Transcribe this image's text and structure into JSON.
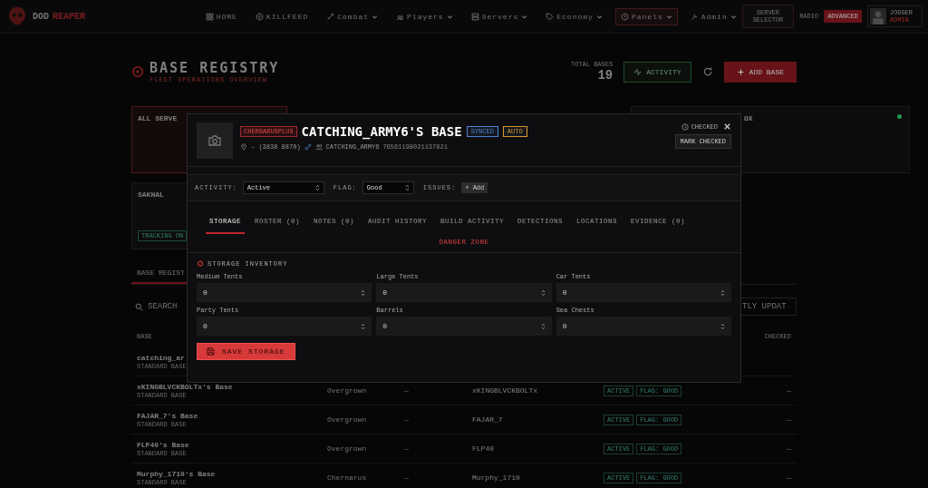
{
  "nav": {
    "brand_first": "DOD",
    "brand_second": "REAPER",
    "items": [
      {
        "label": "HOME",
        "dropdown": false,
        "selected": false
      },
      {
        "label": "KILLFEED",
        "dropdown": false,
        "selected": false
      },
      {
        "label": "Combat",
        "dropdown": true,
        "selected": false
      },
      {
        "label": "Players",
        "dropdown": true,
        "selected": false
      },
      {
        "label": "Servers",
        "dropdown": true,
        "selected": false
      },
      {
        "label": "Economy",
        "dropdown": true,
        "selected": false
      },
      {
        "label": "Panels",
        "dropdown": true,
        "selected": true
      },
      {
        "label": "Admin",
        "dropdown": true,
        "selected": false
      }
    ],
    "server_selector": "SERVER SELECTOR",
    "radio": "RADIO",
    "advanced": "ADVANCED",
    "user_name": "JOGGER",
    "user_role": "ADMIN"
  },
  "header": {
    "title": "BASE REGISTRY",
    "subtitle": "FLEET OPERATIONS OVERVIEW",
    "total_label": "TOTAL BASES",
    "total_value": "19",
    "activity_button": "ACTIVITY",
    "add_button": "ADD BASE"
  },
  "cards": [
    {
      "title": "ALL SERVE",
      "selected": true
    },
    {
      "title": "SAKHAL",
      "selected": false,
      "badge": "TRACKING ON"
    }
  ],
  "side_card": {
    "title": "OX"
  },
  "registry_tab": "BASE REGIST",
  "search_placeholder": "SEARCH",
  "sort_label": "TLY UPDAT",
  "table": {
    "columns": [
      "BASE",
      "CHECKED"
    ],
    "rows": [
      {
        "name": "catching_ar",
        "type": "STANDARD BASE"
      },
      {
        "name": "xKINGBLVCKBOLTx's Base",
        "type": "STANDARD BASE",
        "state": "Overgrown",
        "dash": "—",
        "owner": "xKINGBLVCKBOLTx",
        "status": "ACTIVE",
        "flag": "FLAG: GOOD",
        "checked": "—"
      },
      {
        "name": "FAJAR_7's Base",
        "type": "STANDARD BASE",
        "state": "Overgrown",
        "dash": "—",
        "owner": "FAJAR_7",
        "status": "ACTIVE",
        "flag": "FLAG: GOOD",
        "checked": "—"
      },
      {
        "name": "FLP40's Base",
        "type": "STANDARD BASE",
        "state": "Overgrown",
        "dash": "—",
        "owner": "FLP40",
        "status": "ACTIVE",
        "flag": "FLAG: GOOD",
        "checked": "—"
      },
      {
        "name": "Murphy_1710's Base",
        "type": "STANDARD BASE",
        "state": "Chernarus",
        "dash": "—",
        "owner": "Murphy_1710",
        "status": "ACTIVE",
        "flag": "FLAG: GOOD",
        "checked": "—"
      }
    ]
  },
  "modal": {
    "server_tag": "CHERNARUSPLUS",
    "title": "CATCHING_ARMY6'S BASE",
    "badges": [
      {
        "label": "SYNCED",
        "color": "#4f7fd6"
      },
      {
        "label": "AUTO",
        "color": "#d89a2c"
      }
    ],
    "location": "– (3838 8870)",
    "owner": "CATCHING_ARMY6",
    "owner_id": "76561198021137821",
    "checked_label": "CHECKED",
    "mark_button": "MARK CHECKED",
    "activity_label": "ACTIVITY:",
    "activity_value": "Active",
    "flag_label": "FLAG:",
    "flag_value": "Good",
    "issues_label": "ISSUES:",
    "issues_button": "+ Add",
    "tabs": [
      {
        "label": "STORAGE",
        "selected": true
      },
      {
        "label": "ROSTER (0)",
        "selected": false
      },
      {
        "label": "NOTES (0)",
        "selected": false
      },
      {
        "label": "AUDIT HISTORY",
        "selected": false
      },
      {
        "label": "BUILD ACTIVITY",
        "selected": false
      },
      {
        "label": "DETECTIONS",
        "selected": false
      },
      {
        "label": "LOCATIONS",
        "selected": false
      },
      {
        "label": "EVIDENCE (0)",
        "selected": false
      }
    ],
    "danger_zone": "DANGER ZONE",
    "section_title": "STORAGE INVENTORY",
    "fields": [
      {
        "label": "Medium Tents",
        "value": "0"
      },
      {
        "label": "Large Tents",
        "value": "0"
      },
      {
        "label": "Car Tents",
        "value": "0"
      },
      {
        "label": "Party Tents",
        "value": "0"
      },
      {
        "label": "Barrels",
        "value": "0"
      },
      {
        "label": "Sea Chests",
        "value": "0"
      }
    ],
    "save_button": "SAVE STORAGE"
  }
}
